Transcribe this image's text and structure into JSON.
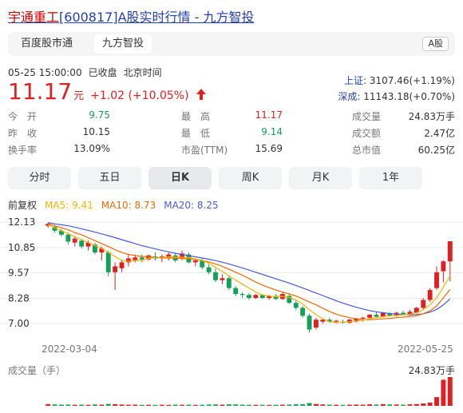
{
  "title": {
    "name_hl": "宇通重工",
    "rest": "[600817]A股实时行情 - 九方智投"
  },
  "tabs": [
    {
      "label": "百度股市通"
    },
    {
      "label": "九方智投"
    }
  ],
  "badge": "A股",
  "status": {
    "time": "05-25 15:00:00",
    "state": "已收盘",
    "zone": "北京时间"
  },
  "price": {
    "value": "11.17",
    "unit": "元",
    "change": "+1.02 (+10.05%)"
  },
  "indices": [
    {
      "name": "上证:",
      "value": "3107.46(+1.19%)"
    },
    {
      "name": "深成:",
      "value": "11143.18(+0.70%)"
    }
  ],
  "stats": [
    [
      {
        "label": "今　开",
        "value": "9.75"
      },
      {
        "label": "最　高",
        "value": "11.17"
      },
      {
        "label": "成交量",
        "value": "24.83万手"
      }
    ],
    [
      {
        "label": "昨　收",
        "value": "10.15"
      },
      {
        "label": "最　低",
        "value": "9.14"
      },
      {
        "label": "成交额",
        "value": "2.47亿"
      }
    ],
    [
      {
        "label": "换手率",
        "value": "13.09%"
      },
      {
        "label": "市盈(TTM)",
        "value": "15.69"
      },
      {
        "label": "总市值",
        "value": "60.25亿"
      }
    ]
  ],
  "periods": [
    "分时",
    "五日",
    "日K",
    "周K",
    "月K",
    "1年"
  ],
  "active_period": "日K",
  "ma": {
    "label": "前复权",
    "ma5": "MA5: 9.41",
    "ma10": "MA10: 8.73",
    "ma20": "MA20: 8.25"
  },
  "colors": {
    "up": "#e02020",
    "down": "#14a05a",
    "ma5": "#f5b400",
    "ma10": "#f06a00",
    "ma20": "#4b5ad7",
    "link": "#2440b3"
  },
  "chart_data": {
    "type": "candlestick",
    "y_ticks": [
      "12.13",
      "10.85",
      "9.57",
      "8.28",
      "7.00"
    ],
    "ylim": [
      6.4,
      12.3
    ],
    "x_labels": [
      "2022-03-04",
      "2022-05-25"
    ],
    "candles": [
      [
        11.95,
        12.13,
        11.85,
        12.05
      ],
      [
        11.9,
        12.0,
        11.6,
        11.7
      ],
      [
        11.7,
        11.8,
        11.4,
        11.5
      ],
      [
        11.5,
        11.6,
        11.0,
        11.15
      ],
      [
        11.1,
        11.4,
        10.9,
        11.3
      ],
      [
        11.2,
        11.3,
        10.8,
        10.9
      ],
      [
        10.9,
        11.2,
        10.7,
        11.1
      ],
      [
        11.0,
        11.1,
        10.5,
        10.6
      ],
      [
        10.6,
        10.9,
        10.2,
        10.8
      ],
      [
        10.6,
        10.7,
        9.4,
        9.6
      ],
      [
        9.6,
        10.1,
        8.7,
        9.9
      ],
      [
        9.8,
        10.2,
        9.6,
        10.1
      ],
      [
        10.1,
        10.5,
        9.9,
        10.3
      ],
      [
        10.2,
        10.5,
        10.1,
        10.35
      ],
      [
        10.35,
        10.5,
        10.1,
        10.25
      ],
      [
        10.25,
        10.5,
        10.2,
        10.45
      ],
      [
        10.4,
        10.6,
        10.2,
        10.3
      ],
      [
        10.3,
        10.5,
        10.1,
        10.4
      ],
      [
        10.35,
        10.6,
        10.2,
        10.5
      ],
      [
        10.45,
        10.55,
        10.1,
        10.2
      ],
      [
        10.3,
        10.7,
        10.2,
        10.55
      ],
      [
        10.5,
        10.6,
        10.05,
        10.1
      ],
      [
        10.1,
        10.3,
        9.9,
        10.2
      ],
      [
        10.2,
        10.3,
        9.75,
        9.85
      ],
      [
        9.85,
        10.0,
        9.5,
        9.6
      ],
      [
        9.6,
        9.8,
        9.1,
        9.2
      ],
      [
        9.2,
        9.5,
        9.0,
        9.3
      ],
      [
        9.3,
        9.4,
        8.7,
        8.8
      ],
      [
        8.8,
        8.9,
        8.4,
        8.5
      ],
      [
        8.5,
        8.6,
        8.3,
        8.45
      ],
      [
        8.45,
        8.55,
        8.2,
        8.3
      ],
      [
        8.3,
        8.5,
        8.25,
        8.45
      ],
      [
        8.45,
        8.5,
        8.25,
        8.3
      ],
      [
        8.3,
        8.45,
        8.2,
        8.4
      ],
      [
        8.4,
        8.5,
        8.2,
        8.25
      ],
      [
        8.25,
        8.6,
        8.2,
        8.5
      ],
      [
        8.4,
        8.5,
        8.0,
        8.05
      ],
      [
        8.05,
        8.2,
        7.7,
        7.8
      ],
      [
        7.8,
        7.9,
        7.3,
        7.4
      ],
      [
        7.4,
        7.5,
        6.55,
        6.7
      ],
      [
        6.8,
        7.3,
        6.7,
        7.2
      ],
      [
        7.1,
        7.25,
        7.0,
        7.2
      ],
      [
        7.2,
        7.3,
        7.05,
        7.1
      ],
      [
        7.1,
        7.2,
        7.0,
        7.15
      ],
      [
        7.1,
        7.2,
        7.0,
        7.05
      ],
      [
        7.05,
        7.25,
        7.0,
        7.2
      ],
      [
        7.15,
        7.3,
        7.05,
        7.25
      ],
      [
        7.25,
        7.35,
        7.1,
        7.3
      ],
      [
        7.3,
        7.5,
        7.2,
        7.45
      ],
      [
        7.45,
        7.6,
        7.3,
        7.35
      ],
      [
        7.35,
        7.6,
        7.3,
        7.55
      ],
      [
        7.5,
        7.6,
        7.35,
        7.4
      ],
      [
        7.4,
        7.6,
        7.35,
        7.55
      ],
      [
        7.55,
        7.65,
        7.4,
        7.45
      ],
      [
        7.45,
        7.7,
        7.4,
        7.6
      ],
      [
        7.55,
        7.85,
        7.5,
        7.8
      ],
      [
        7.8,
        8.3,
        7.7,
        8.2
      ],
      [
        8.2,
        8.8,
        8.1,
        8.7
      ],
      [
        8.8,
        9.9,
        8.7,
        9.6
      ],
      [
        9.65,
        10.2,
        9.1,
        10.15
      ],
      [
        10.15,
        11.17,
        9.14,
        11.17
      ]
    ],
    "ma5": [
      12.0,
      11.85,
      11.7,
      11.55,
      11.4,
      11.25,
      11.1,
      10.95,
      10.8,
      10.6,
      10.4,
      10.2,
      10.15,
      10.2,
      10.2,
      10.3,
      10.35,
      10.35,
      10.38,
      10.36,
      10.36,
      10.34,
      10.28,
      10.2,
      10.05,
      9.85,
      9.65,
      9.42,
      9.2,
      9.0,
      8.8,
      8.6,
      8.45,
      8.4,
      8.36,
      8.38,
      8.32,
      8.2,
      8.0,
      7.7,
      7.45,
      7.25,
      7.1,
      7.05,
      7.08,
      7.1,
      7.12,
      7.18,
      7.25,
      7.3,
      7.35,
      7.4,
      7.42,
      7.45,
      7.48,
      7.55,
      7.7,
      7.95,
      8.3,
      8.85,
      9.41
    ],
    "ma10": [
      12.05,
      11.95,
      11.85,
      11.75,
      11.6,
      11.5,
      11.35,
      11.2,
      11.05,
      10.9,
      10.75,
      10.6,
      10.5,
      10.45,
      10.4,
      10.38,
      10.35,
      10.33,
      10.32,
      10.31,
      10.3,
      10.28,
      10.25,
      10.2,
      10.12,
      10.02,
      9.9,
      9.75,
      9.6,
      9.45,
      9.28,
      9.1,
      8.95,
      8.82,
      8.7,
      8.6,
      8.5,
      8.4,
      8.25,
      8.1,
      7.95,
      7.78,
      7.62,
      7.48,
      7.38,
      7.3,
      7.25,
      7.2,
      7.2,
      7.22,
      7.24,
      7.27,
      7.3,
      7.33,
      7.36,
      7.4,
      7.5,
      7.65,
      7.9,
      8.3,
      8.73
    ],
    "ma20": [
      12.1,
      12.05,
      12.0,
      11.95,
      11.88,
      11.8,
      11.72,
      11.63,
      11.54,
      11.45,
      11.35,
      11.25,
      11.15,
      11.05,
      10.95,
      10.86,
      10.78,
      10.7,
      10.63,
      10.56,
      10.5,
      10.44,
      10.38,
      10.32,
      10.26,
      10.19,
      10.11,
      10.02,
      9.92,
      9.82,
      9.71,
      9.6,
      9.49,
      9.38,
      9.27,
      9.16,
      9.05,
      8.93,
      8.81,
      8.68,
      8.55,
      8.42,
      8.29,
      8.16,
      8.04,
      7.93,
      7.83,
      7.74,
      7.66,
      7.6,
      7.55,
      7.51,
      7.48,
      7.46,
      7.45,
      7.46,
      7.5,
      7.58,
      7.72,
      7.95,
      8.25
    ],
    "volume_label": "成交量（手）",
    "volume_max": "24.83万手",
    "volumes": [
      1.5,
      1.2,
      1.0,
      1.1,
      0.9,
      1.0,
      0.9,
      1.2,
      1.0,
      1.6,
      1.4,
      1.1,
      0.9,
      1.0,
      0.8,
      0.9,
      0.8,
      0.9,
      0.8,
      1.0,
      0.9,
      1.0,
      0.8,
      0.9,
      1.1,
      1.2,
      1.0,
      1.3,
      1.2,
      1.0,
      0.9,
      0.8,
      0.9,
      0.8,
      0.9,
      1.0,
      1.1,
      1.3,
      1.4,
      2.4,
      1.6,
      1.2,
      1.0,
      0.9,
      0.8,
      1.0,
      1.1,
      1.0,
      1.3,
      1.1,
      1.4,
      1.2,
      1.1,
      1.0,
      1.3,
      1.5,
      2.0,
      2.8,
      7.5,
      22.5,
      24.83
    ]
  }
}
